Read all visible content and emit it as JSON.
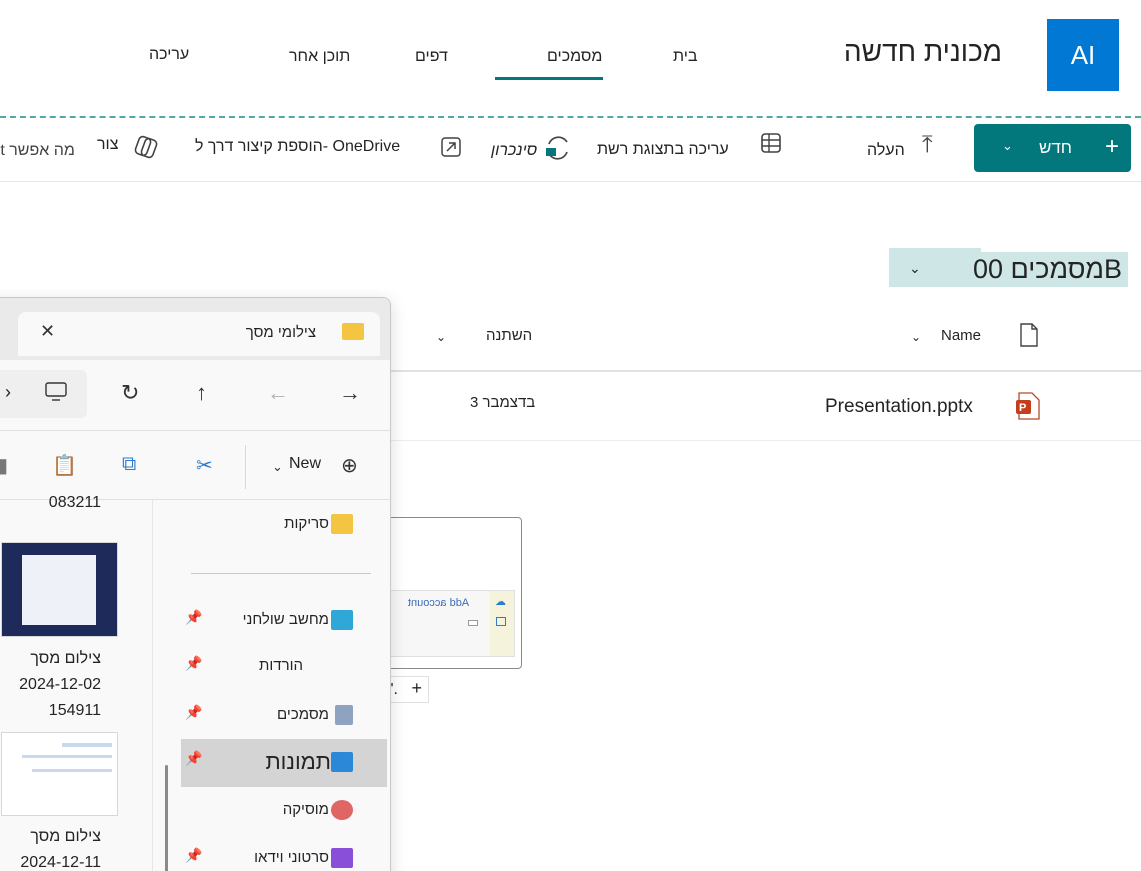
{
  "site": {
    "logo_text": "AI",
    "title": "מכונית חדשה",
    "nav": [
      "בית",
      "מסמכים",
      "דפים",
      "תוכן אחר",
      "עריכה"
    ]
  },
  "commands": {
    "new_label": "חדש",
    "upload": "העלה",
    "grid_edit": "עריכה בתצוגת רשת",
    "sync": "סינכרון",
    "add_shortcut": "הוספת קיצור דרך ל- OneDrive",
    "clip": "צור",
    "overflow": "Copilot מה אפשר"
  },
  "library": {
    "title": "מסמכים 00B",
    "columns": {
      "name": "Name",
      "modified": "השתנה"
    },
    "files": [
      {
        "name": "Presentation.pptx",
        "modified": "3 בדצמבר"
      }
    ]
  },
  "drag": {
    "preview_text": "Add account",
    "tooltip": "לחצן 'העתק'."
  },
  "explorer": {
    "tab_title": "צילומי מסך",
    "toolbar_new": "New",
    "pane": [
      {
        "label": "סריקות"
      },
      {
        "label": "מחשב שולחני"
      },
      {
        "label": "הורדות"
      },
      {
        "label": "מסמכים"
      },
      {
        "label": "תמונות"
      },
      {
        "label": "מוסיקה"
      },
      {
        "label": "סרטוני וידאו"
      }
    ],
    "thumbs": [
      {
        "name": "083211"
      },
      {
        "name": "צילום מסך",
        "date": "2024-12-02",
        "time": "154911"
      },
      {
        "name": "צילום מסך",
        "date": "2024-12-11"
      }
    ]
  },
  "colors": {
    "accent": "#03787c",
    "logo": "#0078d4",
    "highlight": "#cfe6e6"
  }
}
